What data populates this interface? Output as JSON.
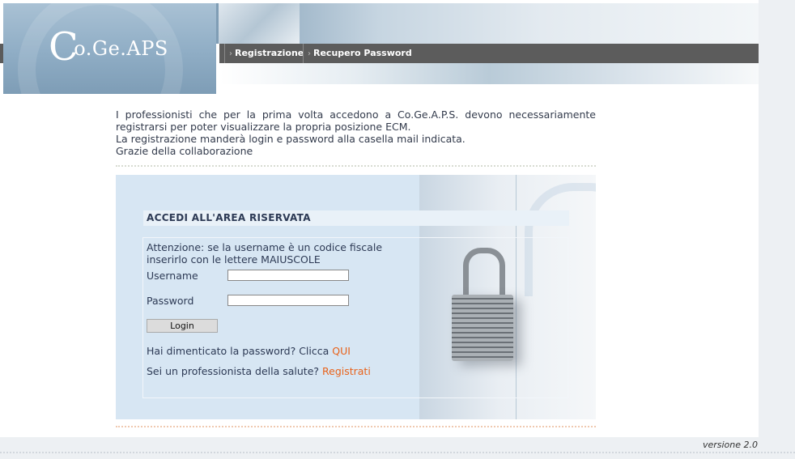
{
  "header": {
    "logo": {
      "big_letter": "C",
      "rest": "o.Ge.APS"
    },
    "nav": [
      {
        "label": "Registrazione"
      },
      {
        "label": "Recupero Password"
      }
    ]
  },
  "intro": {
    "lines": [
      "I professionisti che per la prima volta accedono a Co.Ge.A.P.S. devono necessariamente registrarsi per poter visualizzare la propria posizione ECM.",
      "La registrazione manderà login e password alla casella mail indicata.",
      "Grazie della collaborazione"
    ]
  },
  "login": {
    "title": "ACCEDI ALL'AREA RISERVATA",
    "notice_line1": "Attenzione: se la username è un codice fiscale",
    "notice_line2": "inserirlo con le lettere MAIUSCOLE",
    "username_label": "Username",
    "username_value": "",
    "password_label": "Password",
    "password_value": "",
    "button_label": "Login",
    "forgot_text": "Hai dimenticato la password? Clicca ",
    "forgot_link": "QUI",
    "register_text": "Sei un professionista della salute? ",
    "register_link": "Registrati"
  },
  "footer": {
    "version": "versione 2.0"
  }
}
